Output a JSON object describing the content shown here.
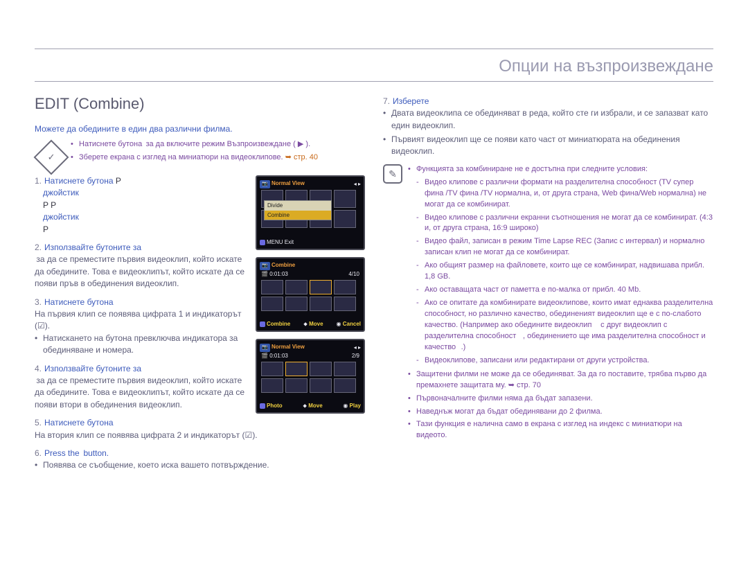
{
  "header": {
    "section_title": "Опции на възпроизвеждане"
  },
  "left": {
    "title": "EDIT (Combine)",
    "subtitle": "Можете да обедините в един два различни филма.",
    "pre_bullets": [
      "Натиснете бутона  за да включите режим Възпроизвеждане ( ▶ ).",
      "Зберете екрана с изглед на миниатюри на видеоклипове."
    ],
    "pre_ref": "➥ стр. 40",
    "steps": {
      "s1_lead": "Натиснете бутона ",
      "s1_frag_a": " джойстик ",
      "s1_frag_b": " джойстик ",
      "s1_p": "P",
      "s1_p2": "P        P",
      "s1_p3": "P ",
      "s2_lead": "Използвайте бутоните за",
      "s2_body": " за да се преместите първия видеоклип, който искате да обедините. Това е видеоклипът, който искате да се появи пръв в обединения видеоклип.",
      "s3_lead": "Натиснете бутона ",
      "s3_body": "На първия клип се появява цифрата 1 и индикаторът (☑).",
      "s3_b1": "Натискането на бутона  превключва индикатора за обединяване и номера.",
      "s4_lead": "Използвайте бутоните за",
      "s4_body": " за да се преместите първия видеоклип, който искате да обедините. Това е видеоклипът, който искате да се появи втори в обединения видеоклип.",
      "s5_lead": "Натиснете бутона ",
      "s5_body": "На втория клип се появява цифрата 2 и индикаторът (☑).",
      "s6_lead": "Press the  button.",
      "s6_b1": "Появява се съобщение, което иска вашето потвърждение."
    },
    "shots": {
      "a": {
        "title": "Normal View",
        "menu1": "Divide",
        "menu2": "Combine",
        "exit": "Exit",
        "menu_btn": "MENU"
      },
      "b": {
        "title": "Combine",
        "time": "0:01:03",
        "counter": "4/10",
        "combine": "Combine",
        "move": "Move",
        "cancel": "Cancel"
      },
      "c": {
        "title": "Normal View",
        "time": "0:01:03",
        "counter": "2/9",
        "photo": "Photo",
        "move": "Move",
        "play": "Play"
      }
    }
  },
  "right": {
    "step7_lead": "Изберете ",
    "step7_bullets": [
      "Двата видеоклипа се обединяват в реда, който сте ги избрали, и се запазват като един видеоклип.",
      "Първият видеоклип ще се появи като част от миниатюрата на обединения видеоклип."
    ],
    "note_intro": "Функцията за комбиниране не е достъпна при следните условия:",
    "note_dashes": [
      "Видео клипове с различни формати на разделителна способност (TV супер фина /TV фина /TV нормална, и, от друга страна, Web фина/Web нормална) не могат да се комбинират.",
      "Видео клипове с различни екранни съотношения не могат да се комбинират. (4:3 и, от друга страна, 16:9 широко)",
      "Видео файл, записан в режим Time Lapse REC (Запис с интервал) и нормално записан клип не могат да се комбинират.",
      "Ако общият размер на файловете, които ще се комбинират, надвишава прибл. 1,8 GB.",
      "Ако оставащата част от паметта е по-малка от прибл. 40 Mb.",
      "Ако се опитате да комбинирате видеоклипове, които имат еднаква разделителна способност, но различно качество, обединеният видеоклип ще е с по-слабото качество. (Например ако обедините видеоклип     с друг видеоклип с разделителна способност    , обединението ще има разделителна способност и качество   .)",
      "Видеоклипове, записани или редактирани от други устройства."
    ],
    "note_bullets": [
      "Защитени филми не може да се обединяват. За да го поставите, трябва първо да премахнете защитата му. ➥ стр. 70",
      "Първоначалните филми няма да бъдат запазени.",
      "Наведнъж могат да бъдат обединявани до 2 филма.",
      "Тази функция е налична само в екрана с изглед на индекс с миниатюри на видеото."
    ]
  },
  "footer": {
    "page": ""
  }
}
